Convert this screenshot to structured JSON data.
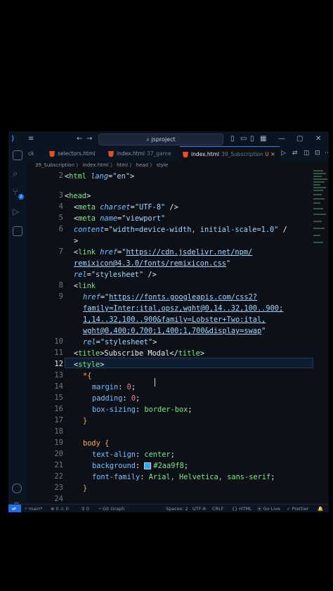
{
  "titlebar": {
    "search_text": "jsproject"
  },
  "tabs": [
    {
      "label": "ck",
      "sub": ""
    },
    {
      "label": "selectors.html",
      "sub": ""
    },
    {
      "label": "index.html",
      "sub": "37_game"
    },
    {
      "label": "index.html",
      "sub": "39_Subscription",
      "mod": "U"
    }
  ],
  "breadcrumbs": "39_Subscription 〉 index.html 〉 html 〉 head 〉 style",
  "gutter": [
    "2",
    "",
    "3",
    "4",
    "5",
    "6",
    "",
    "",
    "7",
    "",
    "",
    "8",
    "9",
    "",
    "",
    "",
    "10",
    "11",
    "12",
    "13",
    "14",
    "15",
    "16",
    "17",
    "18",
    "19",
    "20",
    "21",
    "22",
    "23",
    "24"
  ],
  "statusbar": {
    "branch": "main*",
    "errors": "0",
    "warnings": "0",
    "ports": "0",
    "graph": "Git Graph",
    "spaces": "Spaces: 2",
    "encoding": "UTF-8",
    "eol": "CRLF",
    "lang": "{} HTML",
    "golive": "Go Live",
    "prettier": "Prettier"
  },
  "code": {
    "l2": [
      "<",
      "html",
      " ",
      "lang",
      "=",
      "\"en\"",
      ">"
    ],
    "l4": [
      "<",
      "head",
      ">"
    ],
    "l5": [
      "<",
      "meta",
      " ",
      "charset",
      "=",
      "\"UTF-8\"",
      " />"
    ],
    "l6a": [
      "<",
      "meta",
      " ",
      "name",
      "=",
      "\"viewport\""
    ],
    "l6b": [
      "content",
      "=",
      "\"width=device-width, initial-scale=1.0\"",
      " /"
    ],
    "l6c": ">",
    "l7a": [
      "<",
      "link",
      " ",
      "href",
      "=",
      "\"",
      "https://cdn.jsdelivr.net/npm/"
    ],
    "l7b": [
      "remixicon@4.3.0/fonts/remixicon.css",
      "\""
    ],
    "l7c": [
      "rel",
      "=",
      "\"stylesheet\"",
      " />"
    ],
    "l8": [
      "<",
      "link"
    ],
    "l9a": [
      "href",
      "=",
      "\"",
      "https://fonts.googleapis.com/css2?"
    ],
    "l9b": "family=Inter:ital,opsz,wght@0,14..32,100..900;",
    "l9c": "1,14..32,100..900&family=Lobster+Two:ital,",
    "l9d": [
      "wght@0,400;0,700;1,400;1,700&display=swap",
      "\""
    ],
    "l10": [
      "rel",
      "=",
      "\"stylesheet\"",
      ">"
    ],
    "l11": [
      "<",
      "title",
      ">",
      "Subscribe Modal",
      "</",
      "title",
      ">"
    ],
    "l12": [
      "<",
      "style",
      ">"
    ],
    "l13": [
      "*",
      "{"
    ],
    "l14": [
      "margin",
      ": ",
      "0",
      ";"
    ],
    "l15": [
      "padding",
      ": ",
      "0",
      ";"
    ],
    "l16": [
      "box-sizing",
      ": ",
      "border-box",
      ";"
    ],
    "l17": "}",
    "l19": [
      "body",
      " {"
    ],
    "l20": [
      "text-align",
      ": ",
      "center",
      ";"
    ],
    "l21": [
      "background",
      ": ",
      "#2aa9f8",
      ";"
    ],
    "l22": [
      "font-family",
      ": ",
      "Arial, Helvetica, sans-serif",
      ";"
    ],
    "l23": "}"
  },
  "colors": {
    "accent": "#1f6feb",
    "swatch": "#2aa9f8",
    "html_icon": "#e44d26"
  }
}
